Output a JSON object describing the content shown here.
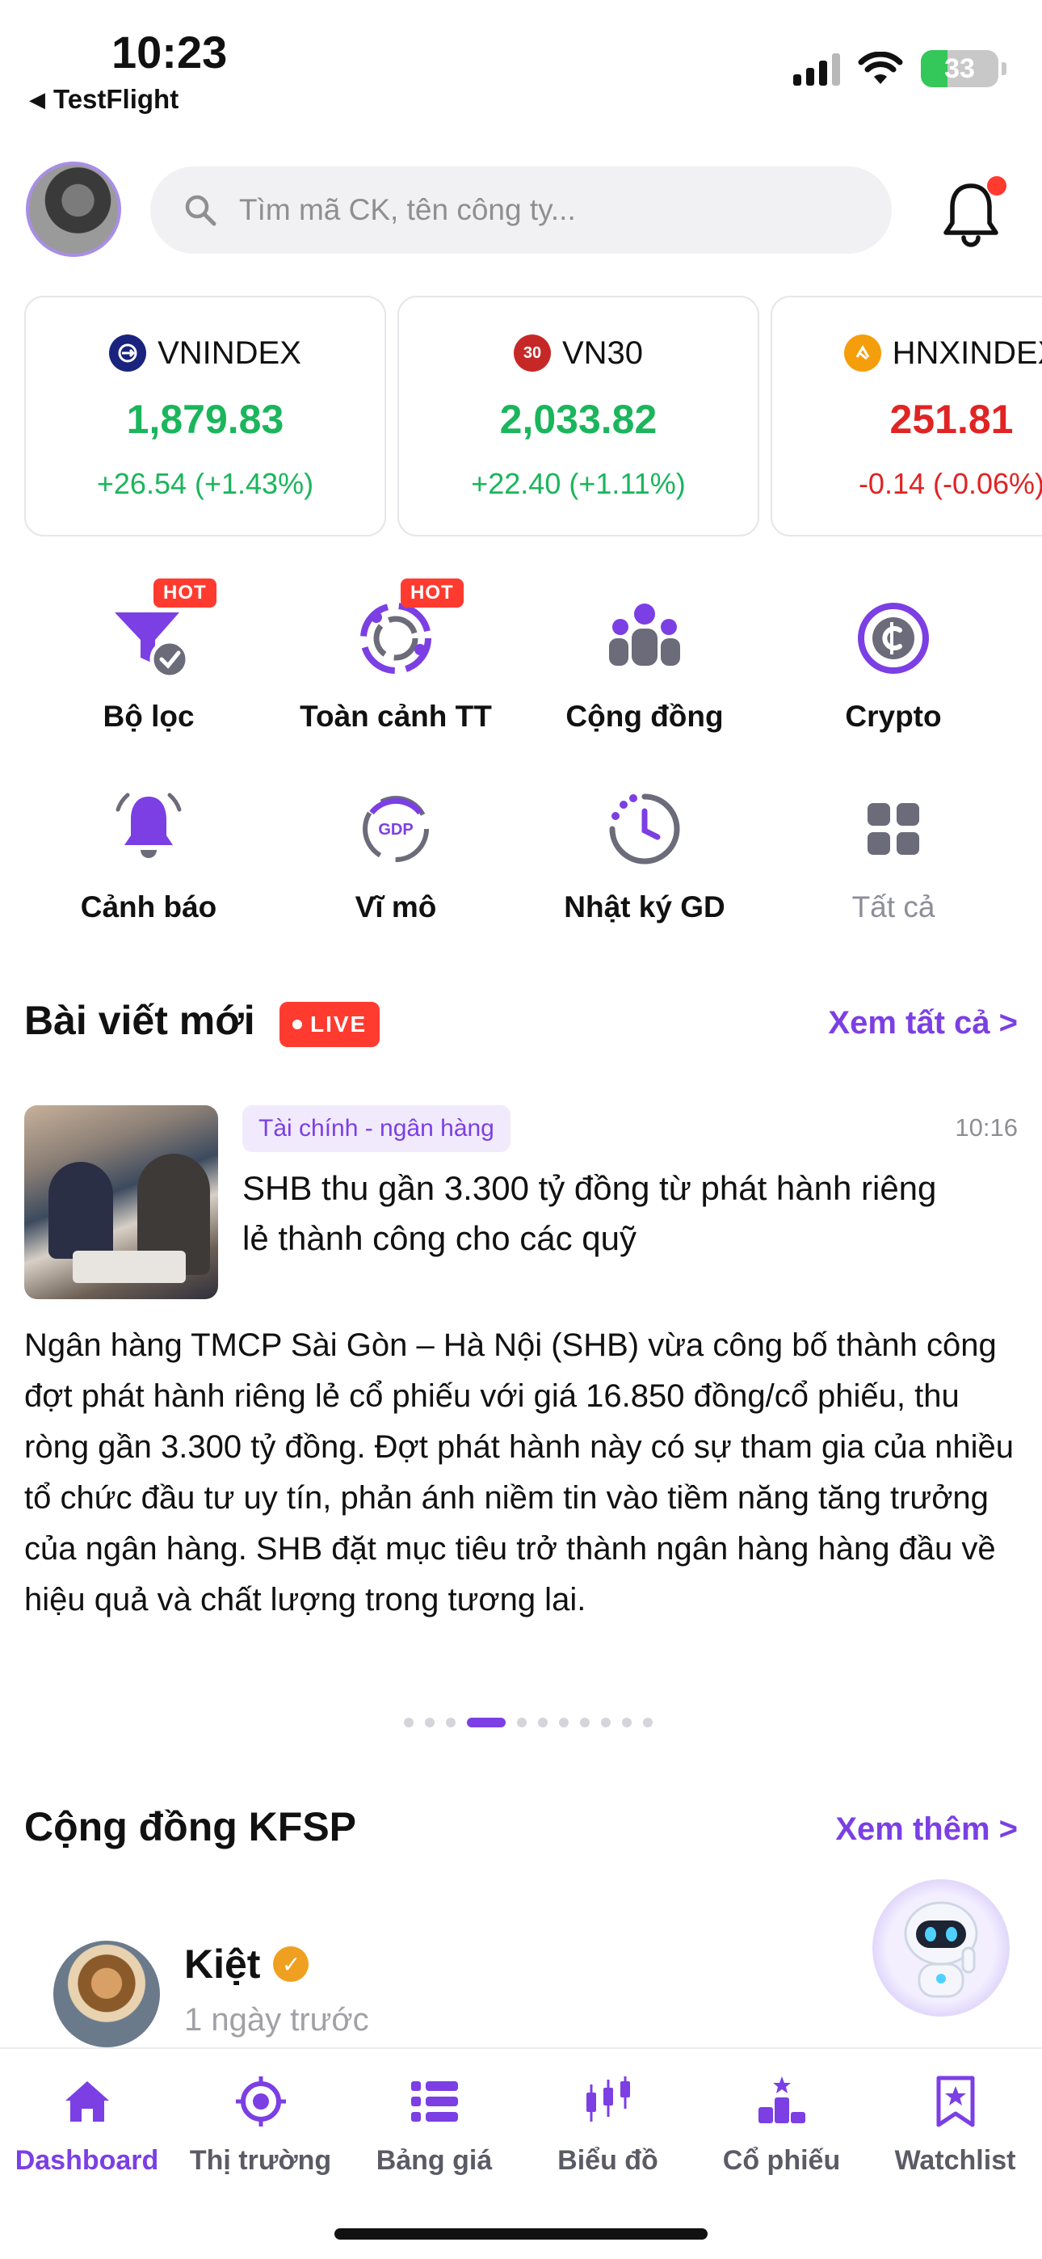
{
  "status_bar": {
    "time": "10:23",
    "back_app": "TestFlight",
    "battery": "33"
  },
  "header": {
    "search_placeholder": "Tìm mã CK, tên công ty..."
  },
  "indices": [
    {
      "name": "VNINDEX",
      "value": "1,879.83",
      "change": "+26.54 (+1.43%)",
      "trend": "up",
      "icon_color": "#1a237e"
    },
    {
      "name": "VN30",
      "value": "2,033.82",
      "change": "+22.40 (+1.11%)",
      "trend": "up",
      "icon_color": "#c62828",
      "icon_text": "30"
    },
    {
      "name": "HNXINDEX",
      "value": "251.81",
      "change": "-0.14 (-0.06%)",
      "trend": "down",
      "icon_color": "#f59e0b"
    }
  ],
  "shortcuts": [
    {
      "label": "Bộ lọc",
      "badge": "HOT",
      "icon": "filter-icon"
    },
    {
      "label": "Toàn cảnh TT",
      "badge": "HOT",
      "icon": "market-overview-icon"
    },
    {
      "label": "Cộng đồng",
      "icon": "community-icon"
    },
    {
      "label": "Crypto",
      "icon": "crypto-icon"
    },
    {
      "label": "Cảnh báo",
      "icon": "alert-bell-icon"
    },
    {
      "label": "Vĩ mô",
      "icon": "gdp-icon",
      "icon_text": "GDP"
    },
    {
      "label": "Nhật ký GD",
      "icon": "trade-journal-icon"
    },
    {
      "label": "Tất cả",
      "icon": "grid-icon"
    }
  ],
  "news_section": {
    "title": "Bài viết mới",
    "live_badge": "LIVE",
    "see_all": "Xem tất cả >",
    "article": {
      "category": "Tài chính - ngân hàng",
      "time": "10:16",
      "title": "SHB thu gần 3.300 tỷ đồng từ phát hành riêng lẻ thành công cho các quỹ",
      "body": "Ngân hàng TMCP Sài Gòn – Hà Nội (SHB) vừa công bố thành công đợt phát hành riêng lẻ cổ phiếu với giá 16.850 đồng/cổ phiếu, thu ròng gần 3.300 tỷ đồng. Đợt phát hành này có sự tham gia của nhiều tổ chức đầu tư uy tín, phản ánh niềm tin vào tiềm năng tăng trưởng của ngân hàng. SHB đặt mục tiêu trở thành ngân hàng hàng đầu về hiệu quả và chất lượng trong tương lai."
    },
    "pager": {
      "total": 11,
      "active": 3
    }
  },
  "community_section": {
    "title": "Cộng đồng KFSP",
    "see_more": "Xem thêm >",
    "post": {
      "author": "Kiệt",
      "time": "1 ngày trước"
    }
  },
  "tabbar": [
    {
      "label": "Dashboard",
      "active": true,
      "icon": "home-icon"
    },
    {
      "label": "Thị trường",
      "icon": "target-icon"
    },
    {
      "label": "Bảng giá",
      "icon": "list-icon"
    },
    {
      "label": "Biểu đồ",
      "icon": "candlestick-icon"
    },
    {
      "label": "Cổ phiếu",
      "icon": "podium-icon"
    },
    {
      "label": "Watchlist",
      "icon": "bookmark-star-icon"
    }
  ],
  "colors": {
    "accent": "#7b3fe4",
    "up": "#1bb55c",
    "down": "#e02424",
    "hot": "#ff3b30"
  }
}
